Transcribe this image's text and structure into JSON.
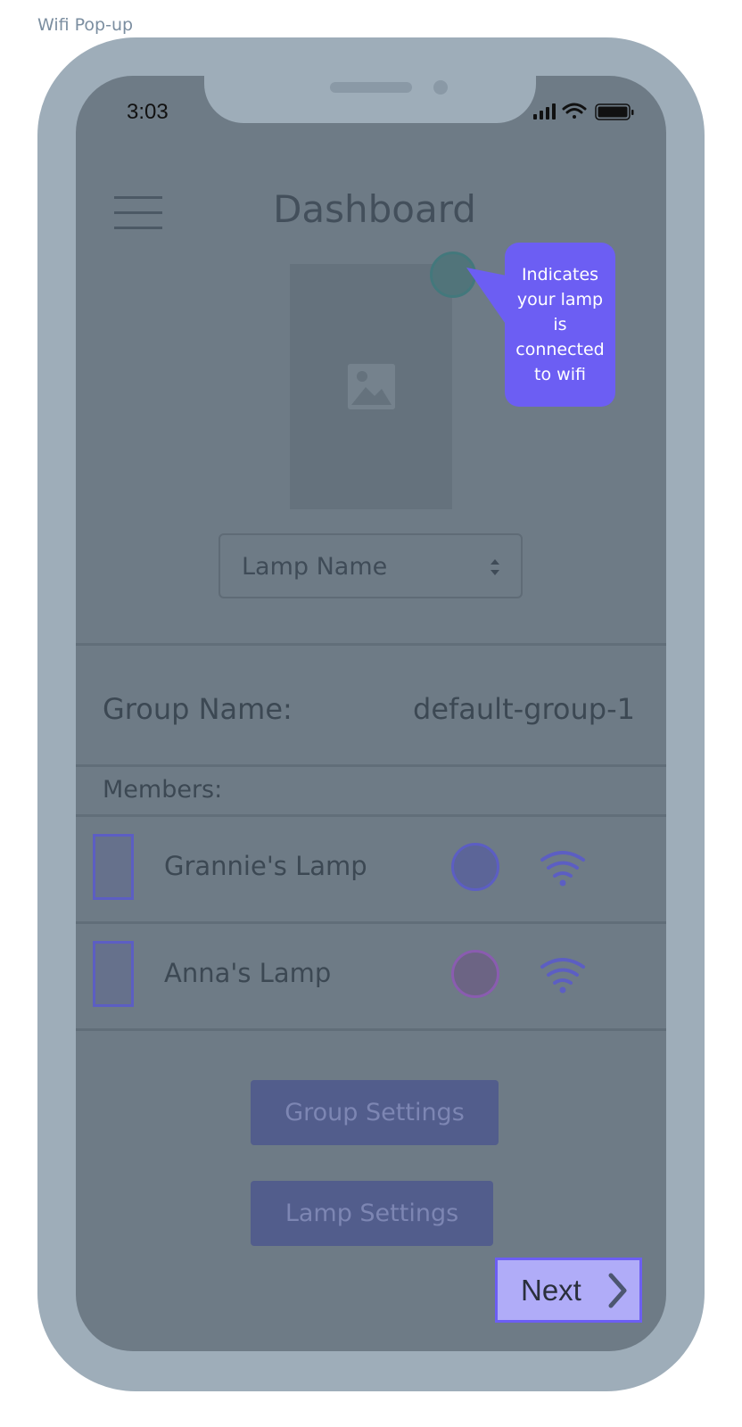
{
  "frame": {
    "label": "Wifi Pop-up"
  },
  "status_bar": {
    "time": "3:03",
    "icons": [
      "signal-icon",
      "wifi-icon",
      "battery-icon"
    ]
  },
  "header": {
    "title": "Dashboard",
    "menu_icon": "hamburger-icon"
  },
  "lamp": {
    "image_icon": "image-placeholder-icon",
    "status_color": "#51747a"
  },
  "tooltip": {
    "text": "Indicates your lamp is connected to wifi",
    "color": "#6c5ef3"
  },
  "lamp_select": {
    "selected": "Lamp Name"
  },
  "group": {
    "label": "Group Name:",
    "value": "default-group-1"
  },
  "members": {
    "label": "Members:",
    "items": [
      {
        "name": "Grannie's Lamp",
        "status_color": "#5c6598",
        "wifi_icon": "wifi-icon"
      },
      {
        "name": "Anna's Lamp",
        "status_color": "#6c6484",
        "wifi_icon": "wifi-icon"
      }
    ]
  },
  "buttons": {
    "group_settings": "Group Settings",
    "lamp_settings": "Lamp Settings",
    "next": "Next"
  }
}
